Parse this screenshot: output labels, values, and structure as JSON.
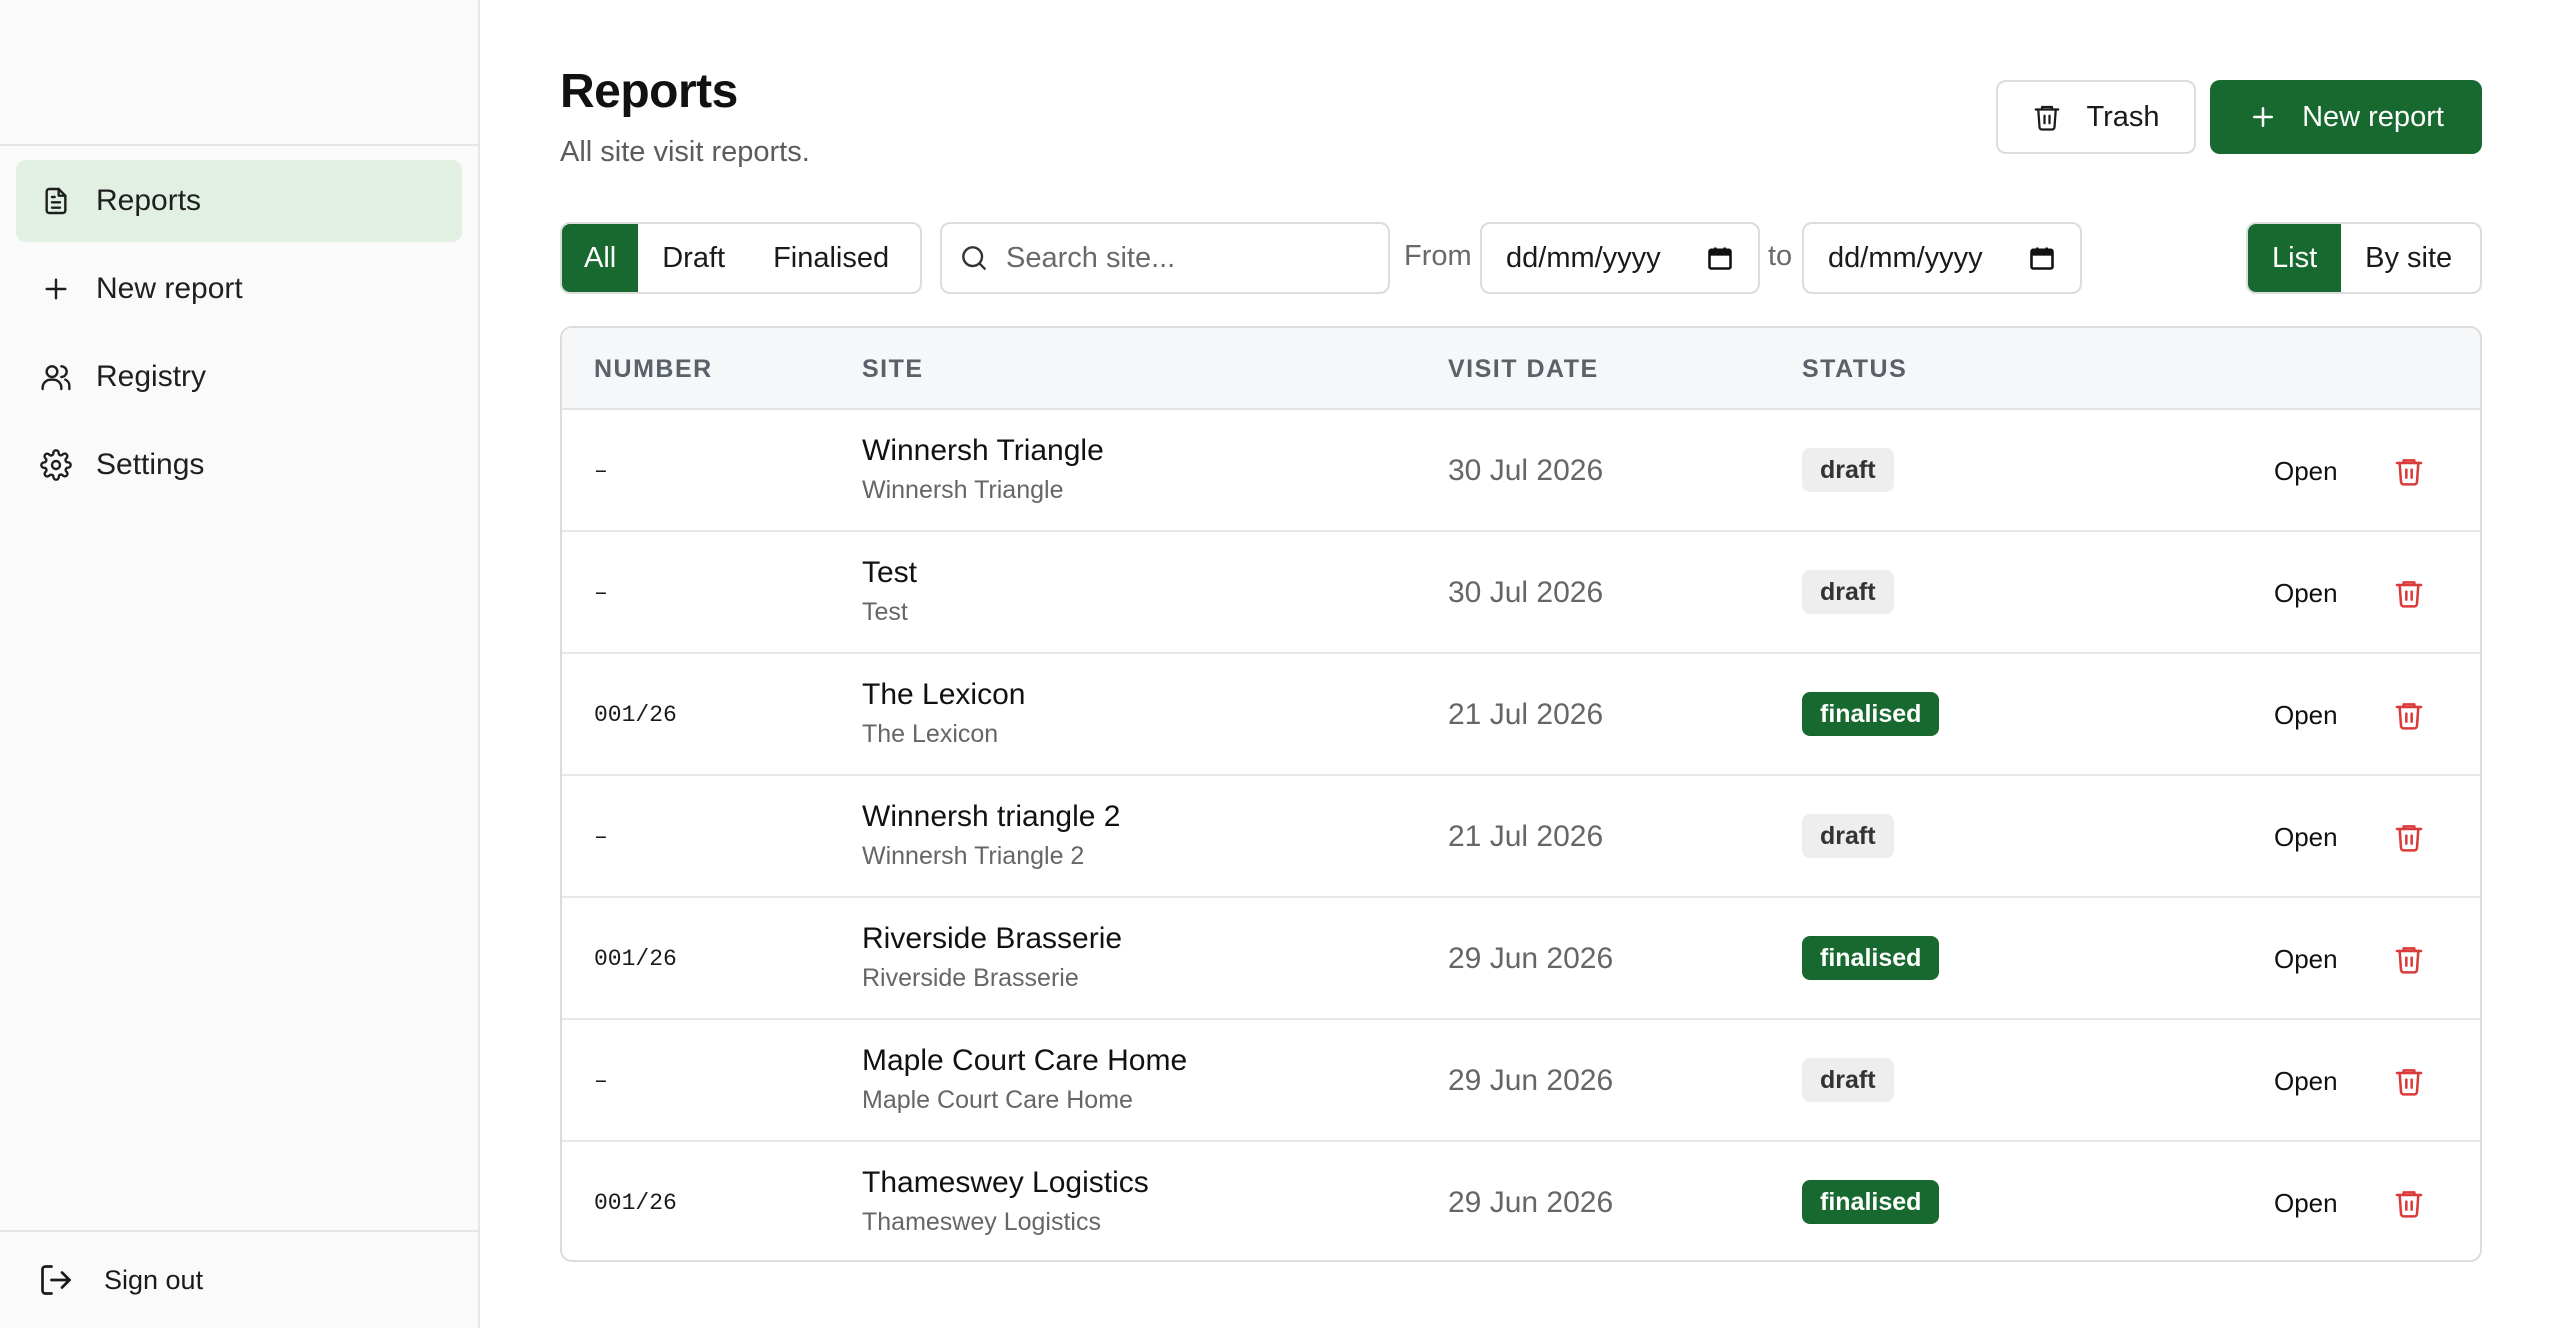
{
  "sidebar": {
    "items": [
      {
        "label": "Reports",
        "icon": "document-icon",
        "active": true
      },
      {
        "label": "New report",
        "icon": "plus-icon",
        "active": false
      },
      {
        "label": "Registry",
        "icon": "users-icon",
        "active": false
      },
      {
        "label": "Settings",
        "icon": "gear-icon",
        "active": false
      }
    ],
    "sign_out": "Sign out"
  },
  "header": {
    "title": "Reports",
    "subtitle": "All site visit reports.",
    "trash_label": "Trash",
    "new_report_label": "New report"
  },
  "filters": {
    "status_options": [
      "All",
      "Draft",
      "Finalised"
    ],
    "status_selected": "All",
    "search_placeholder": "Search site...",
    "from_label": "From",
    "to_label": "to",
    "date_placeholder": "dd/mm/yyyy",
    "view_options": [
      "List",
      "By site"
    ],
    "view_selected": "List"
  },
  "table": {
    "columns": [
      "NUMBER",
      "SITE",
      "VISIT DATE",
      "STATUS"
    ],
    "open_label": "Open",
    "rows": [
      {
        "number": "–",
        "site": "Winnersh Triangle",
        "site_sub": "Winnersh Triangle",
        "visit_date": "30 Jul 2026",
        "status": "draft"
      },
      {
        "number": "–",
        "site": "Test",
        "site_sub": "Test",
        "visit_date": "30 Jul 2026",
        "status": "draft"
      },
      {
        "number": "001/26",
        "site": "The Lexicon",
        "site_sub": "The Lexicon",
        "visit_date": "21 Jul 2026",
        "status": "finalised"
      },
      {
        "number": "–",
        "site": "Winnersh triangle 2",
        "site_sub": "Winnersh Triangle 2",
        "visit_date": "21 Jul 2026",
        "status": "draft"
      },
      {
        "number": "001/26",
        "site": "Riverside Brasserie",
        "site_sub": "Riverside Brasserie",
        "visit_date": "29 Jun 2026",
        "status": "finalised"
      },
      {
        "number": "–",
        "site": "Maple Court Care Home",
        "site_sub": "Maple Court Care Home",
        "visit_date": "29 Jun 2026",
        "status": "draft"
      },
      {
        "number": "001/26",
        "site": "Thameswey Logistics",
        "site_sub": "Thameswey Logistics",
        "visit_date": "29 Jun 2026",
        "status": "finalised"
      }
    ]
  },
  "colors": {
    "accent": "#17692f",
    "active_nav_bg": "#e2efe3",
    "danger": "#d93a3a"
  }
}
